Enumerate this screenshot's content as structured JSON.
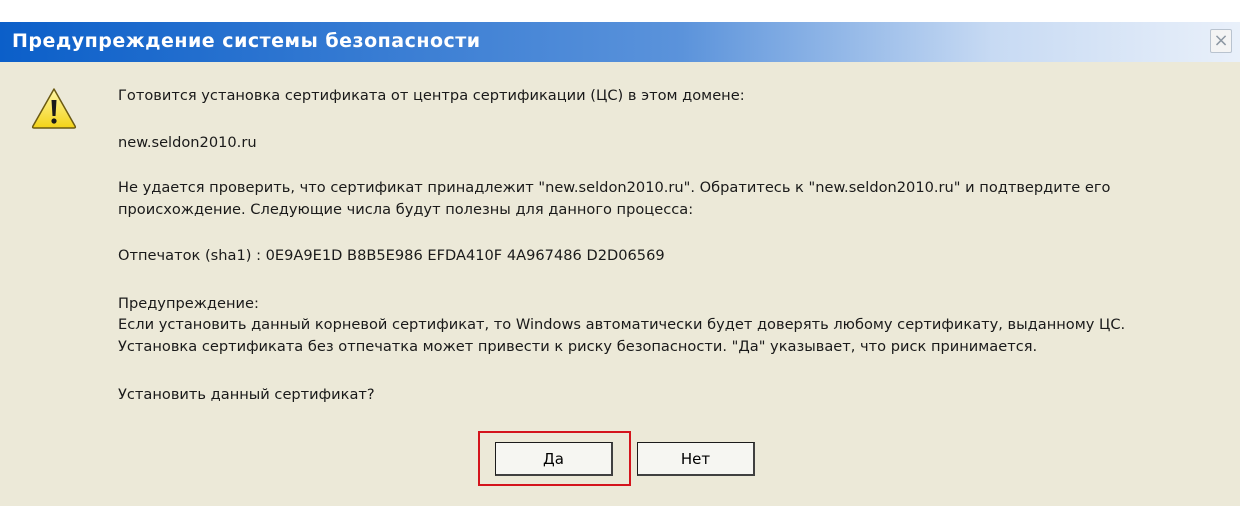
{
  "window": {
    "title": "Предупреждение системы безопасности",
    "close_glyph": "×"
  },
  "icon": "warning-icon",
  "body": {
    "line1": "Готовится установка сертификата от центра сертификации (ЦС) в этом домене:",
    "domain": "new.seldon2010.ru",
    "verify_line1": "Не удается проверить, что сертификат принадлежит \"new.seldon2010.ru\". Обратитесь к \"new.seldon2010.ru\" и подтвердите его",
    "verify_line2": "происхождение. Следующие числа будут полезны для данного процесса:",
    "thumbprint": "Отпечаток (sha1) : 0E9A9E1D B8B5E986 EFDA410F 4A967486 D2D06569",
    "warning_heading": "Предупреждение:",
    "warning_line1": "Если установить данный корневой сертификат, то Windows автоматически будет доверять любому сертификату, выданному ЦС.",
    "warning_line2": "Установка сертификата без отпечатка может привести к риску безопасности. \"Да\" указывает, что риск принимается.",
    "question": "Установить данный сертификат?"
  },
  "buttons": {
    "yes_label": "Да",
    "no_label": "Нет"
  },
  "colors": {
    "highlight": "#d4141c",
    "titlebar": "#0b5fc9",
    "dialog_bg": "#ece9d8"
  }
}
